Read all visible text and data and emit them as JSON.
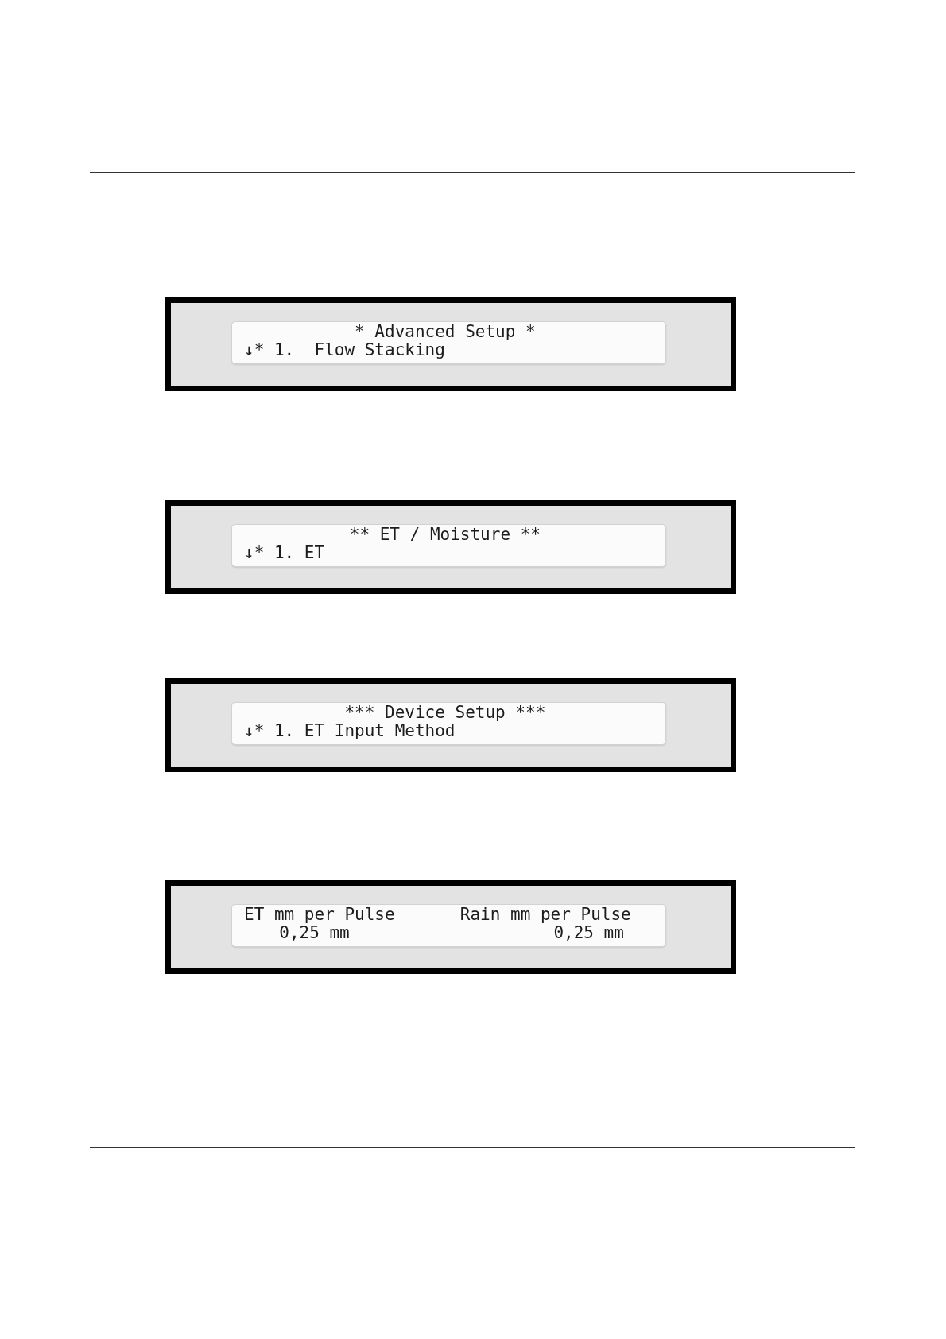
{
  "screens": [
    {
      "kind": "menu",
      "title": "* Advanced Setup *",
      "line": "↓* 1.  Flow Stacking"
    },
    {
      "kind": "menu",
      "title": "** ET / Moisture **",
      "line": "↓* 1. ET"
    },
    {
      "kind": "menu",
      "title": "*** Device Setup ***",
      "line": "↓* 1. ET Input Method"
    },
    {
      "kind": "fields",
      "fields": [
        {
          "label": "ET mm per Pulse",
          "value": "0,25 mm"
        },
        {
          "label": "Rain mm per Pulse",
          "value": "0,25 mm"
        }
      ]
    }
  ]
}
